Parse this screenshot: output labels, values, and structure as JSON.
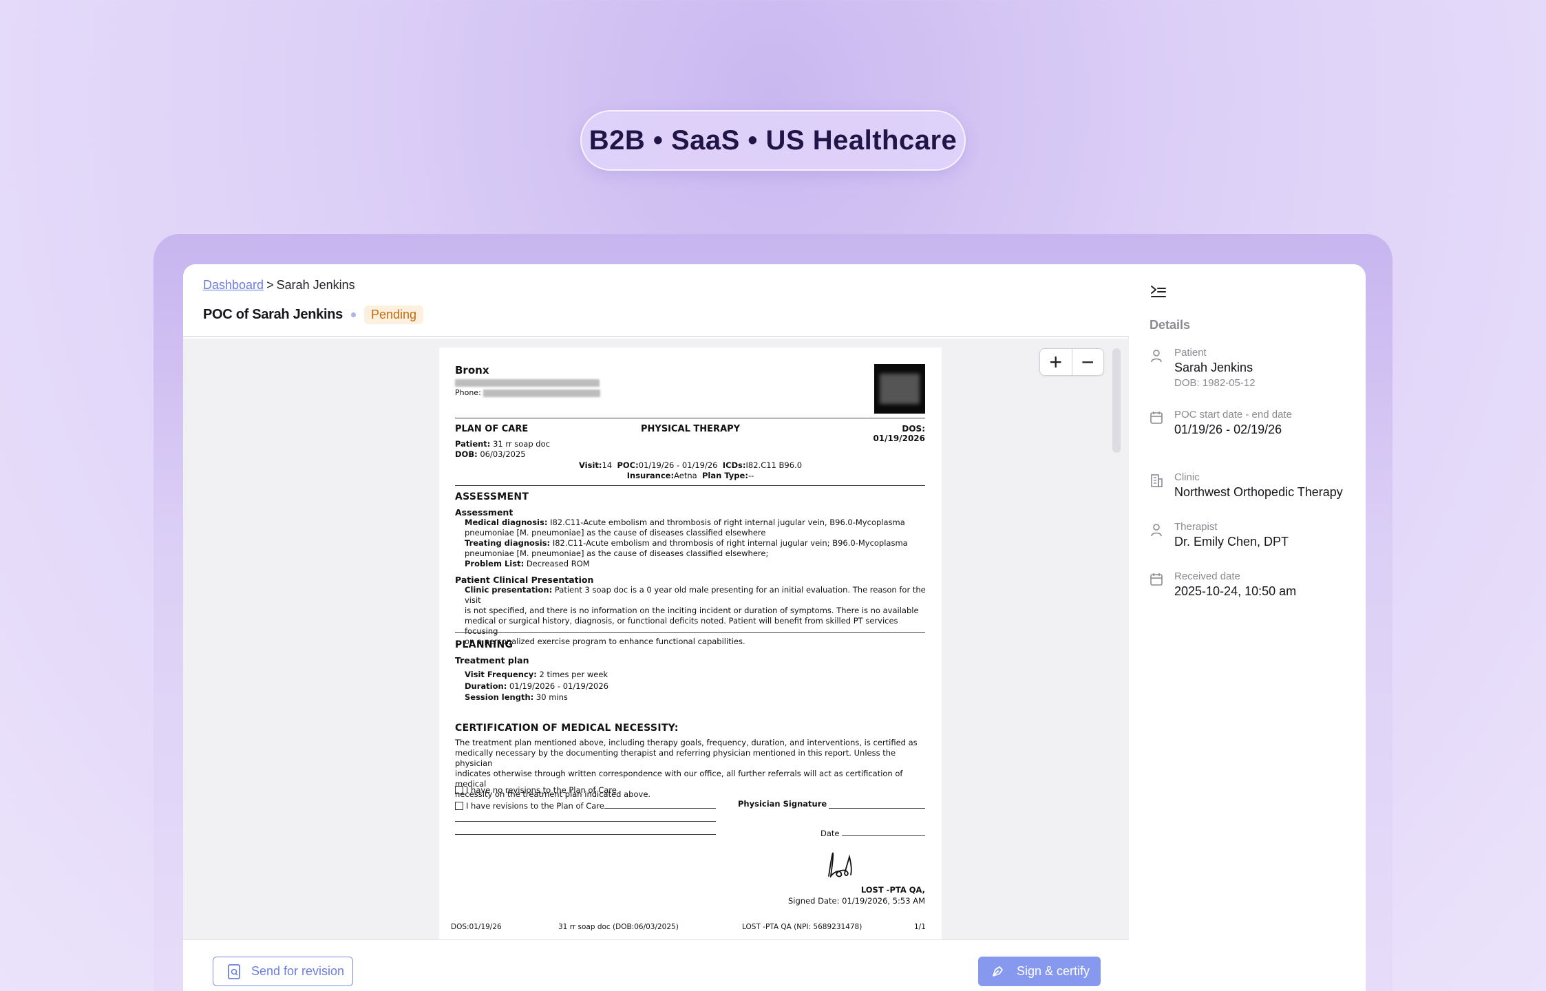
{
  "tagline": "B2B • SaaS • US Healthcare",
  "breadcrumb": {
    "root": "Dashboard",
    "separator": ">",
    "current": "Sarah Jenkins"
  },
  "page": {
    "title": "POC of Sarah Jenkins",
    "status": "Pending"
  },
  "document": {
    "clinic_name": "Bronx",
    "phone_label": "Phone:",
    "section_left": "PLAN OF CARE",
    "section_center": "PHYSICAL THERAPY",
    "dos": "DOS: 01/19/2026",
    "patient_label": "Patient:",
    "patient_value": "31 rr soap doc",
    "dob_label": "DOB:",
    "dob_value": "06/03/2025",
    "visit_label": "Visit:",
    "visit_value": "14",
    "poc_label": "POC:",
    "poc_value": "01/19/26 - 01/19/26",
    "icds_label": "ICDs:",
    "icds_value": "I82.C11 B96.0",
    "insurance_label": "Insurance:",
    "insurance_value": "Aetna",
    "plantype_label": "Plan Type:",
    "plantype_value": "--",
    "assessment_h": "ASSESSMENT",
    "assessment_sub": "Assessment",
    "med_dx_label": "Medical diagnosis:",
    "med_dx_1": "I82.C11-Acute embolism and thrombosis of right internal jugular vein, B96.0-Mycoplasma",
    "med_dx_2": "pneumoniae [M. pneumoniae] as the cause of diseases classified elsewhere",
    "treat_dx_label": "Treating diagnosis:",
    "treat_dx_1": "I82.C11-Acute embolism and thrombosis of right internal jugular vein; B96.0-Mycoplasma",
    "treat_dx_2": "pneumoniae [M. pneumoniae] as the cause of diseases classified elsewhere;",
    "problem_label": "Problem List:",
    "problem_value": "Decreased ROM",
    "clinical_sub": "Patient Clinical Presentation",
    "clinic_pres_label": "Clinic presentation:",
    "clinic_pres_1": "Patient 3 soap doc is a 0 year old male presenting for an initial evaluation. The reason for the visit",
    "clinic_pres_2": "is not specified, and there is no information on the inciting incident or duration of symptoms. There is no available",
    "clinic_pres_3": "medical or surgical history, diagnosis, or functional deficits noted. Patient will benefit from skilled PT services focusing",
    "clinic_pres_4": "on a personalized exercise program to enhance functional capabilities.",
    "planning_h": "PLANNING",
    "treatment_sub": "Treatment plan",
    "freq_label": "Visit Frequency:",
    "freq_value": "2 times per week",
    "duration_label": "Duration:",
    "duration_value": "01/19/2026 - 01/19/2026",
    "session_label": "Session length:",
    "session_value": "30 mins",
    "cert_h": "CERTIFICATION OF MEDICAL NECESSITY:",
    "cert_1": "The treatment plan mentioned above, including therapy goals, frequency, duration, and interventions, is certified as",
    "cert_2": "medically necessary by the documenting therapist and referring physician mentioned in this report. Unless the physician",
    "cert_3": "indicates otherwise through written correspondence with our office, all further referrals will act as certification of medical",
    "cert_4": "necessity on the treatment plan indicated above.",
    "no_revisions": "I have no revisions to the Plan of Care",
    "revisions": "I have revisions to the Plan of Care",
    "phys_sig": "Physician Signature",
    "date_label": "Date",
    "signer": "LOST -PTA QA,",
    "signed_date": "Signed Date: 01/19/2026, 5:53 AM",
    "footer_dos": "DOS:01/19/26",
    "footer_patient": "31 rr soap doc (DOB:06/03/2025)",
    "footer_npi": "LOST -PTA QA (NPI: 5689231478)",
    "footer_page": "1/1"
  },
  "zoom": {
    "in": "+",
    "out": "−"
  },
  "actions": {
    "send_revision": "Send for revision",
    "sign_certify": "Sign & certify"
  },
  "sidebar": {
    "heading": "Details",
    "patient": {
      "label": "Patient",
      "value": "Sarah Jenkins",
      "sub": "DOB: 1982-05-12"
    },
    "poc": {
      "label": "POC start date - end date",
      "value": "01/19/26 - 02/19/26"
    },
    "clinic": {
      "label": "Clinic",
      "value": "Northwest Orthopedic Therapy"
    },
    "therapist": {
      "label": "Therapist",
      "value": "Dr. Emily Chen, DPT"
    },
    "received": {
      "label": "Received date",
      "value": "2025-10-24, 10:50 am"
    }
  },
  "colors": {
    "accent": "#8799ef",
    "link": "#6b7de0",
    "pending_bg": "#fdf0df",
    "pending_text": "#c46a10"
  }
}
